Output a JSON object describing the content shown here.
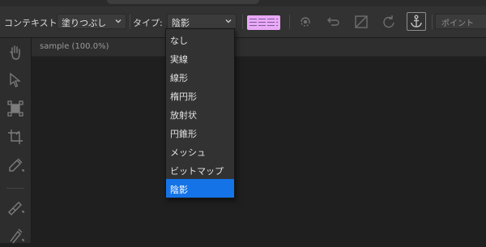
{
  "toolbar": {
    "context_label": "コンテキスト:",
    "context_value": "塗りつぶし",
    "type_label": "タイプ:",
    "type_value": "陰影",
    "point_label": "ポイント"
  },
  "document": {
    "tab_title": "sample (100.0%)"
  },
  "dropdown": {
    "items": [
      "なし",
      "実線",
      "線形",
      "楕円形",
      "放射状",
      "円錐形",
      "メッシュ",
      "ビットマップ",
      "陰影"
    ],
    "selected_index": 8
  },
  "colors": {
    "accent": "#1473e6",
    "pattern_swatch": "#e9a9f7",
    "toolbar_bg": "#323232",
    "canvas_bg": "#1f1f1f"
  },
  "icons": {
    "toolbar": [
      "chevron-down-icon",
      "pattern-icon",
      "transform-icon",
      "undo-icon",
      "copy-fill-icon",
      "reset-icon",
      "anchor-icon"
    ],
    "tools": [
      "hand-icon",
      "pointer-icon",
      "node-icon",
      "crop-icon",
      "eyedropper-icon",
      "knife-icon",
      "fill-brush-icon"
    ]
  }
}
